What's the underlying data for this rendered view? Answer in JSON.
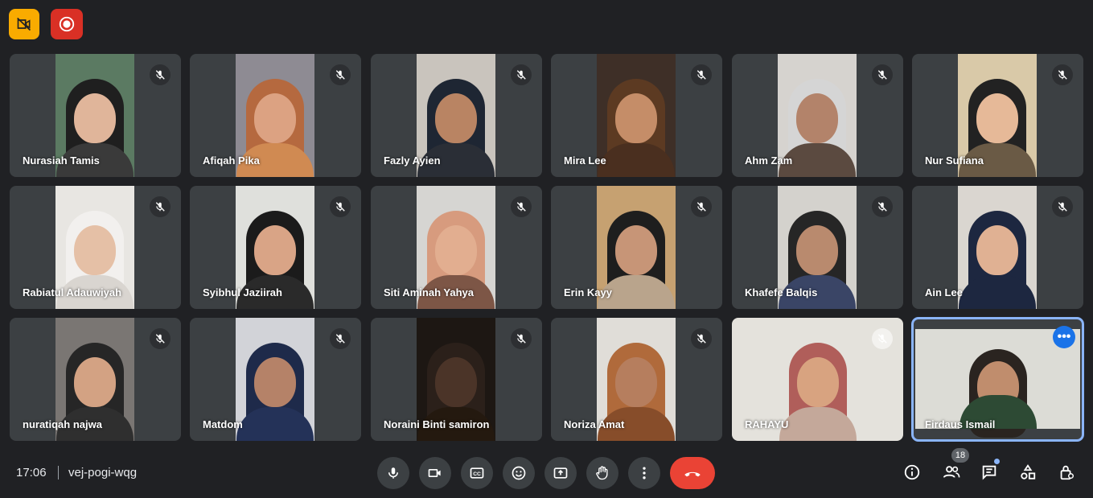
{
  "top_buttons": {
    "camera_off_icon": "video-off-icon",
    "record_icon": "record-icon"
  },
  "participants": [
    {
      "name": "Nurasiah Tamis",
      "bg": "#5b7a62",
      "skin": "#e0b59a",
      "hijab": "#1f1f1f",
      "cloth": "#3a3a3a"
    },
    {
      "name": "Afiqah Pika",
      "bg": "#8e8b93",
      "skin": "#dca282",
      "hijab": "#b5693f",
      "cloth": "#d08a52"
    },
    {
      "name": "Fazly Ayien",
      "bg": "#c9c4bd",
      "skin": "#b98463",
      "hijab": "#1e2633",
      "cloth": "#2a2e36"
    },
    {
      "name": "Mira Lee",
      "bg": "#3e2f27",
      "skin": "#c58d68",
      "hijab": "#5c3a22",
      "cloth": "#4a2f1f"
    },
    {
      "name": "Ahm Zam",
      "bg": "#d6d3cf",
      "skin": "#b3836a",
      "hijab": "#d5d5d5",
      "cloth": "#5b4a40"
    },
    {
      "name": "Nur Sufiana",
      "bg": "#d9c9a8",
      "skin": "#e6b998",
      "hijab": "#222222",
      "cloth": "#6a5a45"
    },
    {
      "name": "Rabiatul Adauwiyah",
      "bg": "#e8e6e2",
      "skin": "#e5c0a6",
      "hijab": "#f2f0ee",
      "cloth": "#d9d5d0"
    },
    {
      "name": "Syibhul Jaziirah",
      "bg": "#dfe0dc",
      "skin": "#d9a486",
      "hijab": "#1b1b1b",
      "cloth": "#2a2a2a"
    },
    {
      "name": "Siti Aminah Yahya",
      "bg": "#d6d5d2",
      "skin": "#e2ae90",
      "hijab": "#d79b7e",
      "cloth": "#7d5646"
    },
    {
      "name": "Erin Kayy",
      "bg": "#c6a171",
      "skin": "#c79577",
      "hijab": "#1e1e1e",
      "cloth": "#b9a48c"
    },
    {
      "name": "Khafefe Balqis",
      "bg": "#d4d2cd",
      "skin": "#b98a6e",
      "hijab": "#262626",
      "cloth": "#3a4566"
    },
    {
      "name": "Ain Lee",
      "bg": "#dad6d0",
      "skin": "#e0b193",
      "hijab": "#1d2740",
      "cloth": "#1d2740"
    },
    {
      "name": "nuratiqah najwa",
      "bg": "#7a7673",
      "skin": "#d3a283",
      "hijab": "#262626",
      "cloth": "#2f2f2f"
    },
    {
      "name": "Matdom",
      "bg": "#d2d3d8",
      "skin": "#b58268",
      "hijab": "#1e2a4a",
      "cloth": "#243258"
    },
    {
      "name": "Noraini Binti samiron",
      "bg": "#1d1713",
      "skin": "#4b3428",
      "hijab": "#2b201a",
      "cloth": "#24190f"
    },
    {
      "name": "Noriza Amat",
      "bg": "#e0ddd8",
      "skin": "#b67e5e",
      "hijab": "#b06a3b",
      "cloth": "#874d2a"
    },
    {
      "name": "RAHAYU",
      "bg": "#e4e2dc",
      "skin": "#d8a380",
      "hijab": "#b05e5a",
      "cloth": "#c4a89a"
    },
    {
      "name": "Firdaus Ismail",
      "bg": "#dcdcd6",
      "skin": "#c08d6d",
      "hijab": "#2a2420",
      "cloth": "#2d4a34"
    }
  ],
  "active_tile_more": "•••",
  "meeting": {
    "time": "17:06",
    "code": "vej-pogi-wqg"
  },
  "controls": [
    "mic-icon",
    "camera-icon",
    "captions-icon",
    "emoji-icon",
    "present-icon",
    "raise-hand-icon",
    "more-options-icon",
    "end-call-icon"
  ],
  "right_controls": {
    "participants_count": "18"
  },
  "colors": {
    "background": "#202124",
    "tile": "#3c4043",
    "hangup": "#ea4335",
    "active_border": "#8ab4f8"
  }
}
